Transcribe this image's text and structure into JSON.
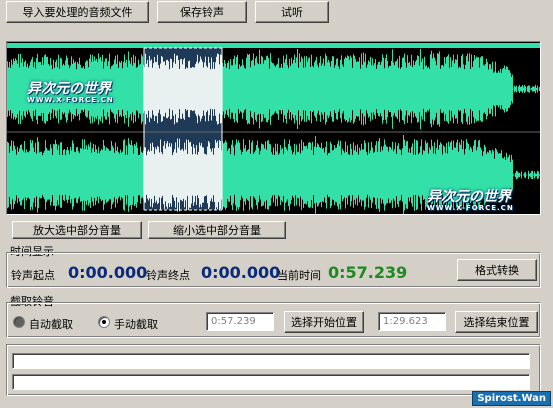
{
  "toolbar": {
    "import_label": "导入要处理的音频文件",
    "save_label": "保存铃声",
    "listen_label": "试听"
  },
  "volume": {
    "increase_label": "放大选中部分音量",
    "decrease_label": "缩小选中部分音量"
  },
  "time_display": {
    "group_title": "时间显示",
    "start_label": "铃声起点",
    "start_value": "0:00.000",
    "end_label": "铃声终点",
    "end_value": "0:00.000",
    "current_label": "当前时间",
    "current_value": "0:57.239",
    "format_button": "格式转换"
  },
  "clip": {
    "group_title": "截取铃音",
    "auto_label": "自动截取",
    "manual_label": "手动截取",
    "start_field": "0:57.239",
    "start_button": "选择开始位置",
    "end_field": "1:29.623",
    "end_button": "选择结束位置"
  },
  "logo": {
    "brand": "异次元の世界",
    "site": "WWW.X-FORCE.CN"
  },
  "watermark": "Spirost.Wan",
  "colors": {
    "waveform": "#33e0a8",
    "selection": "#1e3a56",
    "blue_time": "#0a2a7a",
    "green_time": "#1e8a1e"
  }
}
